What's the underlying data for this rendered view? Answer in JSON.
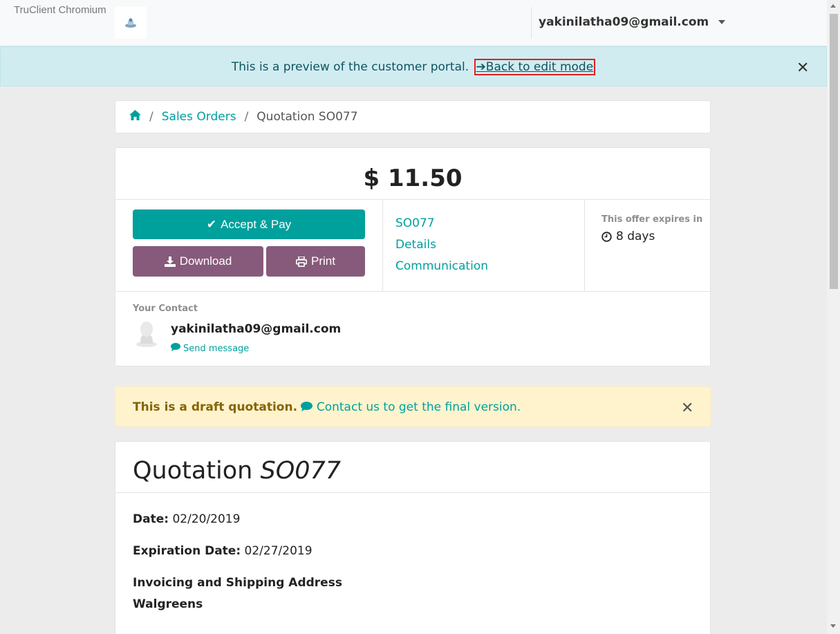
{
  "app": {
    "title": "TruClient Chromium"
  },
  "navbar": {
    "user_email": "yakinilatha09@gmail.com"
  },
  "preview_alert": {
    "text": "This is a preview of the customer portal.",
    "link_label": "Back to edit mode"
  },
  "breadcrumb": {
    "items": [
      "Sales Orders",
      "Quotation SO077"
    ]
  },
  "summary": {
    "amount": "$ 11.50",
    "accept_label": "Accept & Pay",
    "download_label": "Download",
    "print_label": "Print",
    "links": [
      "SO077",
      "Details",
      "Communication"
    ],
    "expires_label": "This offer expires in",
    "expires_value": "8 days"
  },
  "contact": {
    "label": "Your Contact",
    "name": "yakinilatha09@gmail.com",
    "send_message": "Send message"
  },
  "draft_alert": {
    "strong_text": "This is a draft quotation.",
    "link_text": "Contact us to get the final version."
  },
  "quotation": {
    "title_prefix": "Quotation",
    "title_ref": "SO077",
    "date_label": "Date:",
    "date_value": "02/20/2019",
    "expiration_label": "Expiration Date:",
    "expiration_value": "02/27/2019",
    "address_heading": "Invoicing and Shipping Address",
    "address_name": "Walgreens"
  },
  "colors": {
    "primary": "#00a09d",
    "secondary": "#875a7b",
    "info_bg": "#d1ecf1",
    "warning_bg": "#fff3cd"
  }
}
